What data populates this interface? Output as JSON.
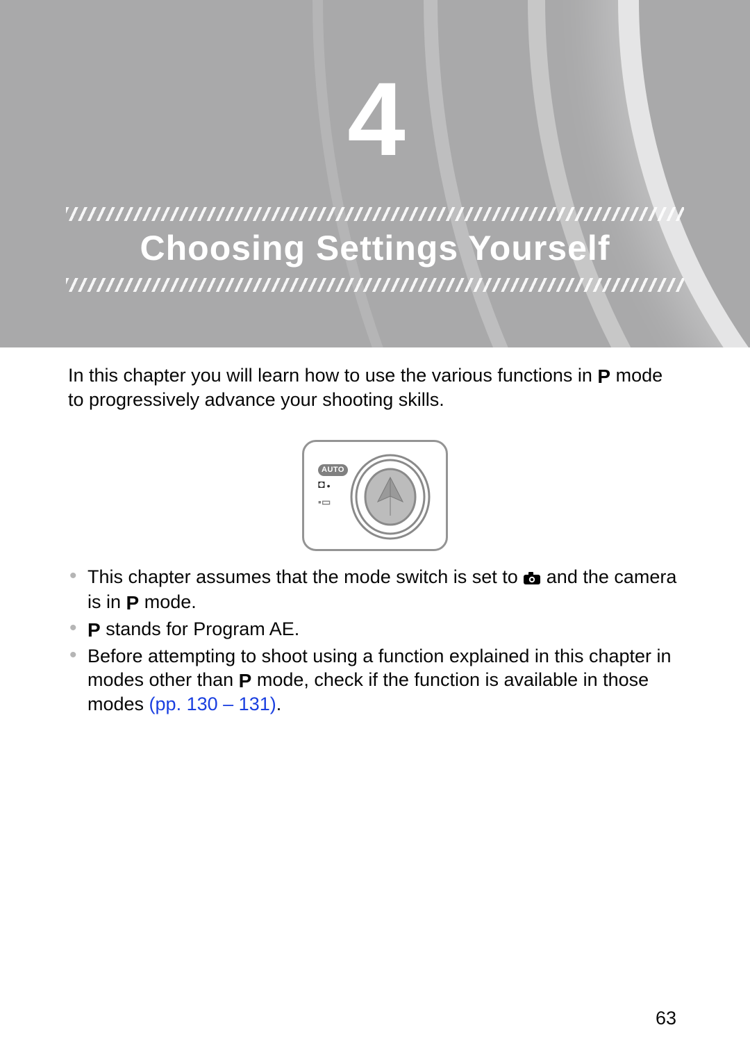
{
  "chapter": {
    "number": "4",
    "title": "Choosing Settings Yourself"
  },
  "intro": {
    "part1": "In this chapter you will learn how to use the various functions in ",
    "p_icon": "P",
    "part2": " mode to progressively advance your shooting skills."
  },
  "illustration": {
    "auto_label": "AUTO"
  },
  "bullets": {
    "b1": {
      "part1": "This chapter assumes that the mode switch is set to ",
      "part2": " and the camera is in ",
      "p_icon": "P",
      "part3": " mode."
    },
    "b2": {
      "p_icon": "P",
      "part1": " stands for Program AE."
    },
    "b3": {
      "part1": "Before attempting to shoot using a function explained in this chapter in modes other than ",
      "p_icon": "P",
      "part2": " mode, check if the function is available in those modes ",
      "link_prefix": "(pp. ",
      "link_p1": "130",
      "link_sep": " – ",
      "link_p2": "131",
      "link_suffix": ")",
      "period": "."
    }
  },
  "page_number": "63"
}
